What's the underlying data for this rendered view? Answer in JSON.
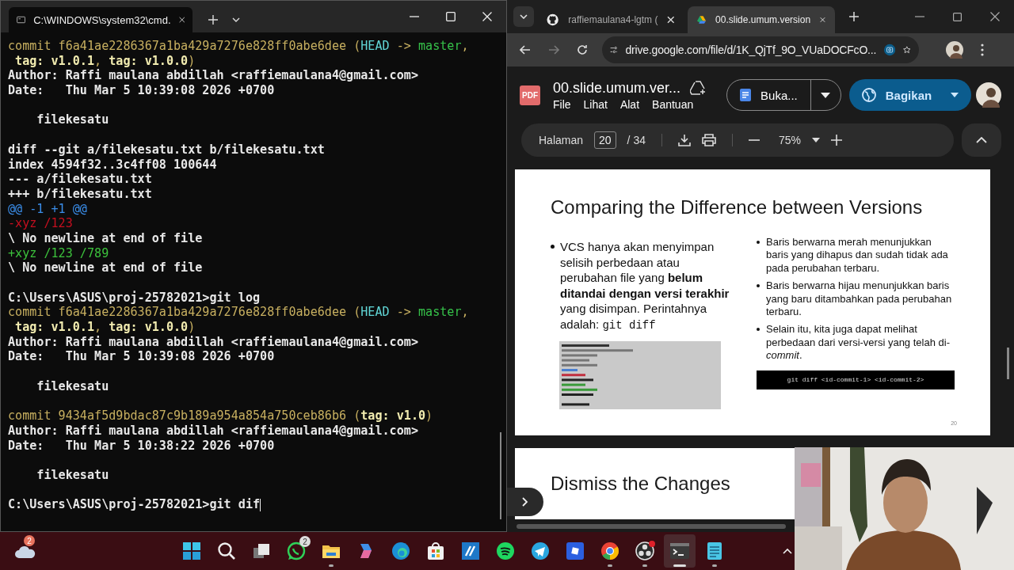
{
  "terminal": {
    "tab_title": "C:\\WINDOWS\\system32\\cmd.",
    "lines": [
      {
        "kind": "text",
        "segments": [
          {
            "text": "commit f6a41ae2286367a1ba429a7276e828ff0abe6dee (",
            "kind": "commit"
          },
          {
            "text": "HEAD",
            "kind": "head"
          },
          {
            "text": " -> ",
            "kind": "commit"
          },
          {
            "text": "master",
            "kind": "branch"
          },
          {
            "text": ",",
            "kind": "commit"
          }
        ]
      },
      {
        "kind": "text",
        "segments": [
          {
            "text": " tag: v1.0.1",
            "kind": "tag"
          },
          {
            "text": ", ",
            "kind": "commit"
          },
          {
            "text": "tag: v1.0.0",
            "kind": "tag"
          },
          {
            "text": ")",
            "kind": "commit"
          }
        ]
      },
      {
        "kind": "text",
        "segments": [
          {
            "text": "Author: Raffi maulana abdillah <raffiemaulana4@gmail.com>",
            "kind": "text"
          }
        ]
      },
      {
        "kind": "text",
        "segments": [
          {
            "text": "Date:   Thu Mar 5 10:39:08 2026 +0700",
            "kind": "text"
          }
        ]
      },
      {
        "kind": "blank"
      },
      {
        "kind": "text",
        "segments": [
          {
            "text": "    filekesatu",
            "kind": "text"
          }
        ]
      },
      {
        "kind": "blank"
      },
      {
        "kind": "text",
        "segments": [
          {
            "text": "diff --git a/filekesatu.txt b/filekesatu.txt",
            "kind": "text"
          }
        ]
      },
      {
        "kind": "text",
        "segments": [
          {
            "text": "index 4594f32..3c4ff08 100644",
            "kind": "text"
          }
        ]
      },
      {
        "kind": "text",
        "segments": [
          {
            "text": "--- a/filekesatu.txt",
            "kind": "text"
          }
        ]
      },
      {
        "kind": "text",
        "segments": [
          {
            "text": "+++ b/filekesatu.txt",
            "kind": "text"
          }
        ]
      },
      {
        "kind": "text",
        "segments": [
          {
            "text": "@@ -1 +1 @@",
            "kind": "hunk"
          }
        ]
      },
      {
        "kind": "text",
        "segments": [
          {
            "text": "-xyz /123",
            "kind": "removed"
          }
        ]
      },
      {
        "kind": "text",
        "segments": [
          {
            "text": "\\ No newline at end of file",
            "kind": "text"
          }
        ]
      },
      {
        "kind": "text",
        "segments": [
          {
            "text": "+xyz /123 /789",
            "kind": "added"
          }
        ]
      },
      {
        "kind": "text",
        "segments": [
          {
            "text": "\\ No newline at end of file",
            "kind": "text"
          }
        ]
      },
      {
        "kind": "blank"
      },
      {
        "kind": "text",
        "segments": [
          {
            "text": "C:\\Users\\ASUS\\proj-25782021>git log",
            "kind": "text"
          }
        ]
      },
      {
        "kind": "text",
        "segments": [
          {
            "text": "commit f6a41ae2286367a1ba429a7276e828ff0abe6dee (",
            "kind": "commit"
          },
          {
            "text": "HEAD",
            "kind": "head"
          },
          {
            "text": " -> ",
            "kind": "commit"
          },
          {
            "text": "master",
            "kind": "branch"
          },
          {
            "text": ",",
            "kind": "commit"
          }
        ]
      },
      {
        "kind": "text",
        "segments": [
          {
            "text": " tag: v1.0.1",
            "kind": "tag"
          },
          {
            "text": ", ",
            "kind": "commit"
          },
          {
            "text": "tag: v1.0.0",
            "kind": "tag"
          },
          {
            "text": ")",
            "kind": "commit"
          }
        ]
      },
      {
        "kind": "text",
        "segments": [
          {
            "text": "Author: Raffi maulana abdillah <raffiemaulana4@gmail.com>",
            "kind": "text"
          }
        ]
      },
      {
        "kind": "text",
        "segments": [
          {
            "text": "Date:   Thu Mar 5 10:39:08 2026 +0700",
            "kind": "text"
          }
        ]
      },
      {
        "kind": "blank"
      },
      {
        "kind": "text",
        "segments": [
          {
            "text": "    filekesatu",
            "kind": "text"
          }
        ]
      },
      {
        "kind": "blank"
      },
      {
        "kind": "text",
        "segments": [
          {
            "text": "commit 9434af5d9bdac87c9b189a954a854a750ceb86b6 (",
            "kind": "commit"
          },
          {
            "text": "tag: v1.0",
            "kind": "tag"
          },
          {
            "text": ")",
            "kind": "commit"
          }
        ]
      },
      {
        "kind": "text",
        "segments": [
          {
            "text": "Author: Raffi maulana abdillah <raffiemaulana4@gmail.com>",
            "kind": "text"
          }
        ]
      },
      {
        "kind": "text",
        "segments": [
          {
            "text": "Date:   Thu Mar 5 10:38:22 2026 +0700",
            "kind": "text"
          }
        ]
      },
      {
        "kind": "blank"
      },
      {
        "kind": "text",
        "segments": [
          {
            "text": "    filekesatu",
            "kind": "text"
          }
        ]
      },
      {
        "kind": "blank"
      },
      {
        "kind": "prompt",
        "segments": [
          {
            "text": "C:\\Users\\ASUS\\proj-25782021>git dif",
            "kind": "text"
          }
        ]
      }
    ]
  },
  "browser": {
    "tabs": [
      {
        "title": "raffiemaulana4-lgtm (",
        "kind": "github",
        "selected": false
      },
      {
        "title": "00.slide.umum.version",
        "kind": "drive",
        "selected": true
      }
    ],
    "url": "drive.google.com/file/d/1K_QjTf_9O_VUaDOCFcO...",
    "file_badge": "PDF",
    "doc_title": "00.slide.umum.ver...",
    "menu": [
      "File",
      "Lihat",
      "Alat",
      "Bantuan"
    ],
    "open_button": "Buka...",
    "share_button": "Bagikan",
    "page_label": "Halaman",
    "page": "20",
    "page_total": "/ 34",
    "zoom": "75%",
    "slide": {
      "title": "Comparing the Difference between Versions",
      "left_bullet": "VCS hanya akan menyimpan selisih perbedaan atau perubahan file yang **belum ditandai dengan versi terakhir** yang disimpan. Perintahnya adalah:",
      "left_code": "git diff",
      "right_bullets": [
        "Baris berwarna merah menunjukkan baris yang dihapus dan sudah tidak ada pada perubahan terbaru.",
        "Baris berwarna hijau menunjukkan baris yang baru ditambahkan pada perubahan terbaru.",
        "Selain itu, kita juga dapat melihat perbedaan dari versi-versi yang telah di-*commit*."
      ],
      "command": "git diff <id-commit-1> <id-commit-2>",
      "page_number": "20"
    },
    "next_slide_title": "Dismiss the Changes"
  },
  "taskbar": {
    "weather_badge": "2",
    "apps": [
      {
        "kind": "start",
        "running": false,
        "active": false
      },
      {
        "kind": "search",
        "running": false,
        "active": false
      },
      {
        "kind": "taskview",
        "running": false,
        "active": false
      },
      {
        "kind": "whatsapp",
        "running": false,
        "active": false,
        "badge": "2"
      },
      {
        "kind": "files",
        "running": true,
        "active": false
      },
      {
        "kind": "copilot",
        "running": false,
        "active": false
      },
      {
        "kind": "edge",
        "running": false,
        "active": false
      },
      {
        "kind": "store",
        "running": false,
        "active": false
      },
      {
        "kind": "editor",
        "running": false,
        "active": false
      },
      {
        "kind": "spotify",
        "running": false,
        "active": false
      },
      {
        "kind": "telegram",
        "running": false,
        "active": false
      },
      {
        "kind": "roblox",
        "running": false,
        "active": false
      },
      {
        "kind": "chrome",
        "running": true,
        "active": false
      },
      {
        "kind": "obs",
        "running": true,
        "active": false
      },
      {
        "kind": "terminal",
        "running": true,
        "active": true
      },
      {
        "kind": "notepad",
        "running": true,
        "active": false
      }
    ]
  }
}
